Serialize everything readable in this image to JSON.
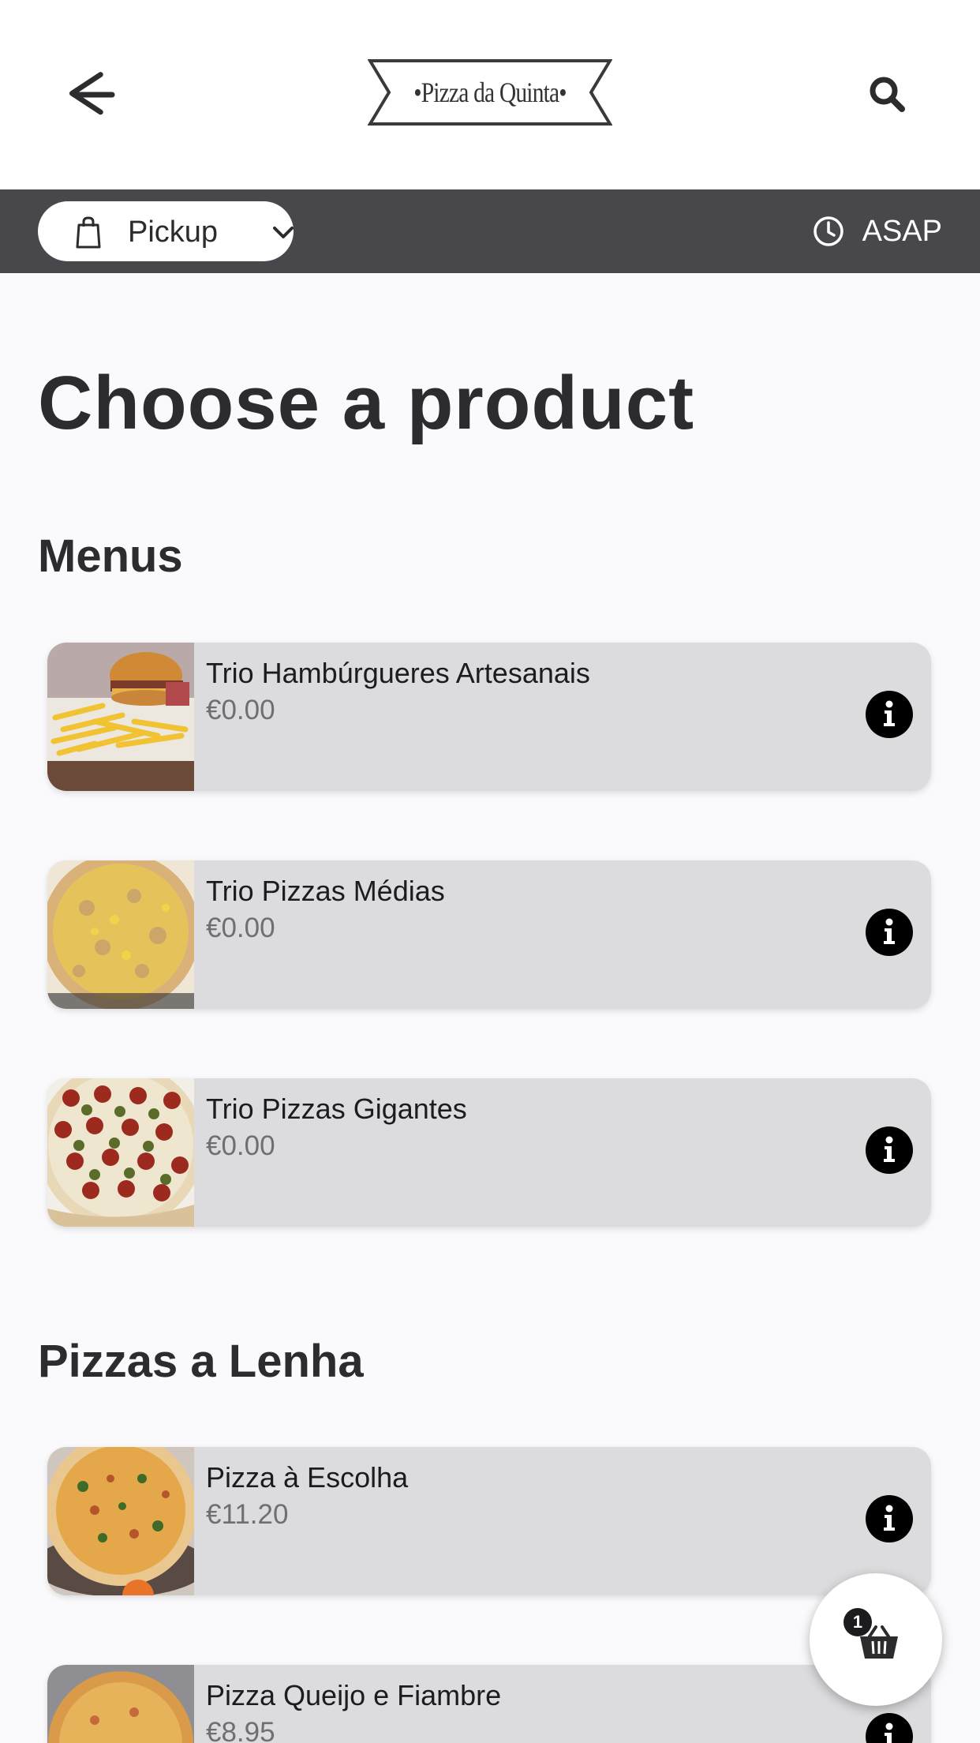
{
  "header": {
    "logo_text": "•Pizza da Quinta•"
  },
  "order_bar": {
    "mode_label": "Pickup",
    "time_label": "ASAP"
  },
  "main": {
    "title": "Choose a product",
    "sections": [
      {
        "title": "Menus",
        "items": [
          {
            "name": "Trio Hambúrgueres Artesanais",
            "price": "€0.00"
          },
          {
            "name": "Trio Pizzas Médias",
            "price": "€0.00"
          },
          {
            "name": "Trio Pizzas Gigantes",
            "price": "€0.00"
          }
        ]
      },
      {
        "title": "Pizzas a Lenha",
        "items": [
          {
            "name": "Pizza à Escolha",
            "price": "€11.20"
          },
          {
            "name": "Pizza Queijo e Fiambre",
            "price": "€8.95"
          }
        ]
      }
    ]
  },
  "cart": {
    "count": "1"
  },
  "icons": {
    "back": "arrow-left-icon",
    "search": "search-icon",
    "bag": "shopping-bag-icon",
    "chevron": "chevron-down-icon",
    "clock": "clock-icon",
    "info": "info-icon",
    "basket": "basket-icon"
  },
  "colors": {
    "order_bar": "#48484c",
    "card": "#dcdcde",
    "text": "#2c2c2e",
    "price": "#6e6e73"
  }
}
